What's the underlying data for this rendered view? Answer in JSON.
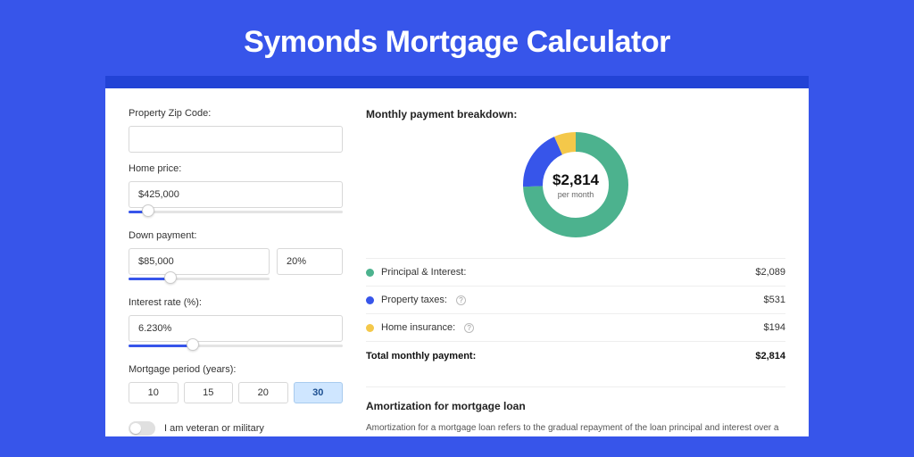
{
  "title": "Symonds Mortgage Calculator",
  "form": {
    "zip_label": "Property Zip Code:",
    "zip_value": "",
    "home_price_label": "Home price:",
    "home_price_value": "$425,000",
    "down_payment_label": "Down payment:",
    "down_payment_value": "$85,000",
    "down_payment_pct": "20%",
    "interest_label": "Interest rate (%):",
    "interest_value": "6.230%",
    "period_label": "Mortgage period (years):",
    "periods": [
      "10",
      "15",
      "20",
      "30"
    ],
    "period_active": "30",
    "veteran_label": "I am veteran or military"
  },
  "breakdown": {
    "title": "Monthly payment breakdown:",
    "center_amount": "$2,814",
    "center_sub": "per month",
    "items": [
      {
        "label": "Principal & Interest:",
        "value": "$2,089",
        "color": "green",
        "info": false
      },
      {
        "label": "Property taxes:",
        "value": "$531",
        "color": "blue",
        "info": true
      },
      {
        "label": "Home insurance:",
        "value": "$194",
        "color": "yellow",
        "info": true
      }
    ],
    "total_label": "Total monthly payment:",
    "total_value": "$2,814"
  },
  "amort": {
    "title": "Amortization for mortgage loan",
    "text": "Amortization for a mortgage loan refers to the gradual repayment of the loan principal and interest over a specified"
  },
  "chart_data": {
    "type": "pie",
    "title": "Monthly payment breakdown",
    "series": [
      {
        "name": "Principal & Interest",
        "value": 2089,
        "color": "#4cb28e"
      },
      {
        "name": "Property taxes",
        "value": 531,
        "color": "#3755ea"
      },
      {
        "name": "Home insurance",
        "value": 194,
        "color": "#f4c84a"
      }
    ],
    "total": 2814,
    "center_label": "$2,814 per month"
  }
}
